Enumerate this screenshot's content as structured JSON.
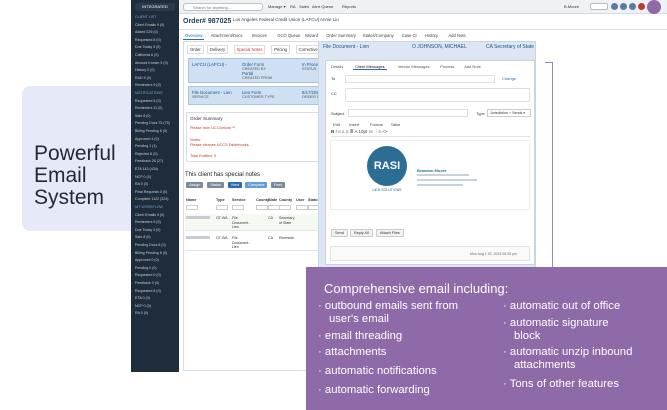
{
  "headline": [
    "Powerful",
    "Email",
    "System"
  ],
  "app": {
    "logo_text": "INTEGRATED",
    "search_placeholder": "Search for anything...",
    "top_nav": [
      "Manage ▾",
      "RA",
      "Sales",
      "Alert Queue",
      "Reports"
    ],
    "user": "B.Moore",
    "order_title": "Order# 987025",
    "order_client": "Los Angeles Federal Credit Union (LAFCU)",
    "order_contact": "Annie Liu",
    "tabs": [
      "Overview",
      "Attachment/Docs",
      "Invoices",
      "GCO Queue",
      "Wizard",
      "Order Summary",
      "States/Company",
      "Case Ct",
      "History",
      "Add Note"
    ],
    "sub_tabs": [
      "Order",
      "Delivery",
      "Special Notes",
      "Pricing",
      "Corrective Actions"
    ],
    "sidebar": [
      {
        "t": "CLIENT LIST",
        "sec": true
      },
      {
        "t": "Client Emails 9 (0)"
      },
      {
        "t": "Added 229 (0)"
      },
      {
        "t": "Requested 8 (0)"
      },
      {
        "t": "Due Today 3 (0)"
      },
      {
        "t": "California 6 (0)"
      },
      {
        "t": "Amount Known 9 (0)"
      },
      {
        "t": "History 0 (0)"
      },
      {
        "t": "RAD 5 (0)"
      },
      {
        "t": "Reminders 9 (0)"
      },
      {
        "t": "NOTIFICATIONS",
        "sec": true
      },
      {
        "t": "Requested 8 (0)"
      },
      {
        "t": "Reminders 11 (0)"
      },
      {
        "t": "Sale 8 (0)"
      },
      {
        "t": "Pending Docs 75 (75)"
      },
      {
        "t": "Billing Pending 8 (0)"
      },
      {
        "t": "Approved 4 (0)"
      },
      {
        "t": "Pending 1 (1)"
      },
      {
        "t": "Rejected 8 (0)"
      },
      {
        "t": "Feedback 26 (27)"
      },
      {
        "t": "ETA 143 (434)"
      },
      {
        "t": "NCP 0 (0)"
      },
      {
        "t": "RA 0 (0)"
      },
      {
        "t": "Final Requests 0 (0)"
      },
      {
        "t": "Complete 1122 (324)"
      },
      {
        "t": "MY WORKFLOW",
        "sec": true
      },
      {
        "t": "Client Emails 9 (0)"
      },
      {
        "t": "Reminders 9 (0)"
      },
      {
        "t": "Due Today 3 (0)"
      },
      {
        "t": "Sale 8 (0)"
      },
      {
        "t": "Pending Docs 8 (0)"
      },
      {
        "t": "Billing Pending 8 (0)"
      },
      {
        "t": "Approved 0 (0)"
      },
      {
        "t": "Pending 0 (0)"
      },
      {
        "t": "Requested 0 (0)"
      },
      {
        "t": "Feedback 0 (0)"
      },
      {
        "t": "Requested 8 (0)"
      },
      {
        "t": "ETA 0 (0)"
      },
      {
        "t": "NCP 0 (0)"
      },
      {
        "t": "RA 0 (0)"
      }
    ],
    "left": {
      "box1": {
        "name": "LAFCU (LAFCU) -",
        "form_label": "Order Form",
        "form_sub": "CREATED BY",
        "portal": "Portal",
        "portal_sub": "CREATED FROM",
        "status": "In Process",
        "status_sub": "STATUS"
      },
      "box2": {
        "name": "File Document - Lien",
        "name_sub": "SERVICE",
        "type": "Lien Form",
        "type_sub": "CUSTOMER TYPE",
        "date": "8/17/2024 10:05am",
        "date_sub": "ORDER DATE",
        "inv": "INVOICED"
      },
      "summary_title": "Order Summary",
      "summary_lines": [
        "Please from UCCDeluxe™.",
        "Notes:",
        "Please cleanse UCCS Tabliebooks.",
        "Total Entitled: 0"
      ],
      "special_notes": "This client has special notes",
      "row_buttons": [
        "Assign",
        "Status",
        "Next",
        "Complete",
        "Fees"
      ],
      "right_buttons": [
        "Courier Sheet/Report",
        "Invoice",
        "All Group",
        "Approve",
        "Clear"
      ],
      "table_headers": [
        "Name",
        "Type",
        "Service",
        "County",
        "State",
        "County",
        "User",
        "Status",
        "Invoice",
        "Bill Group",
        "File Date",
        "Filed"
      ],
      "rows": [
        {
          "type": "OT-WA",
          "service": "File Document - Lien",
          "state": "CA",
          "county": "Secretary of State",
          "bill": "Bill Group: 1",
          "date": "06/17/24",
          "filed": "22456841/1234"
        },
        {
          "type": "OT-WA",
          "service": "File Document - Lien",
          "state": "CA",
          "county": "Riverside",
          "bill": "Bill Group: 1",
          "date": "11/30/11",
          "filed": "Set"
        }
      ]
    },
    "right": {
      "title": "File Document - Lien",
      "client": "O JOHNSON, MICHAEL",
      "state": "CA Secretary of State",
      "email_tabs": [
        "Details",
        "Client Messages",
        "Vendor Messages",
        "Process",
        "Add Note"
      ],
      "to_label": "To",
      "cc_label": "CC",
      "change": "Change",
      "subject_label": "Subject",
      "type_label": "Type",
      "type_value": "Jurisdiction + Sends ▾",
      "editor_menu": [
        "Edit",
        "Insert",
        "Format",
        "Table"
      ],
      "logo": "RASI",
      "logo_sub": "LIEN SOLUTIONS",
      "sig_name": "Brandon Moore",
      "buttons": [
        "Send",
        "Reply All",
        "Attach Files"
      ],
      "timestamp": "Mon Aug 1 00, 2024 06:35 pm"
    }
  },
  "features": {
    "title": "Comprehensive email including:",
    "left": [
      "outbound emails sent from",
      "user's email",
      "email threading",
      "attachments",
      "automatic notifications",
      "automatic forwarding"
    ],
    "right": [
      "automatic out of office",
      "automatic signature",
      "block",
      "automatic unzip inbound",
      "attachments",
      "Tons of other features"
    ]
  },
  "colors": {
    "accent": "#8e6aa8",
    "sidebar": "#1f2c3a",
    "headline_bg": "#e6e9f7"
  }
}
